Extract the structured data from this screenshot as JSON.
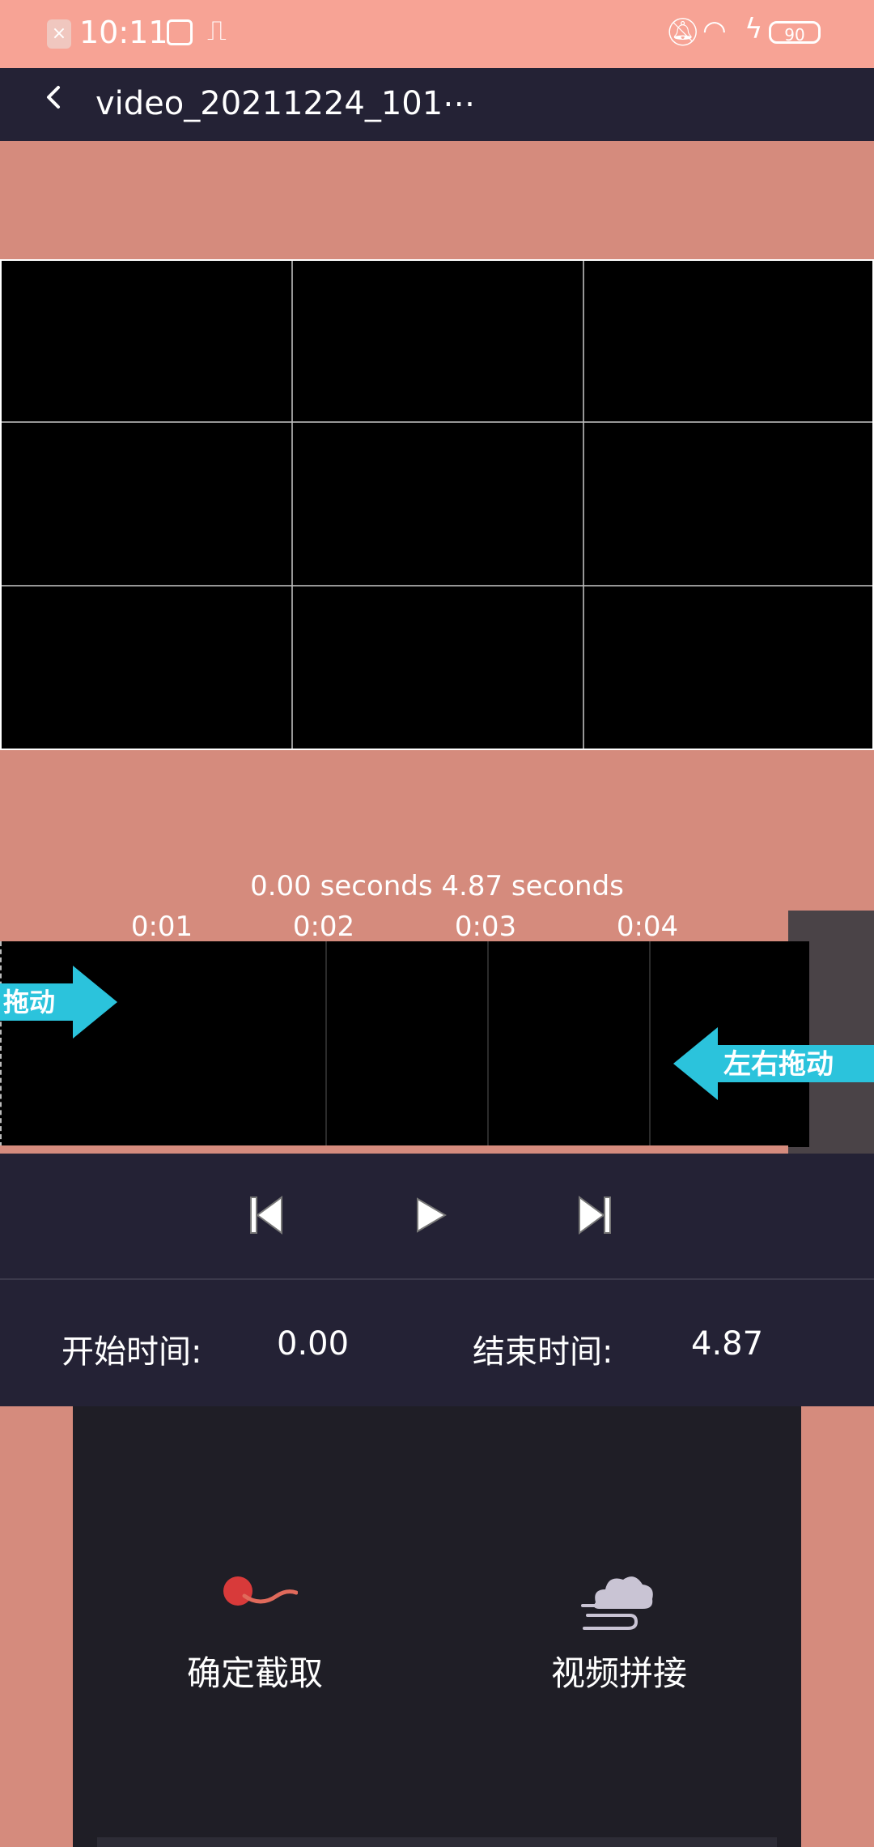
{
  "status_bar": {
    "time": "10:11",
    "battery": "90"
  },
  "header": {
    "title": "video_20211224_101⋯"
  },
  "timeline": {
    "range_label": "0.00 seconds 4.87 seconds",
    "ticks": [
      "0:01",
      "0:02",
      "0:03",
      "0:04"
    ],
    "drag_left_text": "拖动",
    "drag_right_text": "左右拖动"
  },
  "times": {
    "start_label": "开始时间:",
    "start_value": "0.00",
    "end_label": "结束时间:",
    "end_value": "4.87"
  },
  "actions": {
    "confirm_label": "确定截取",
    "concat_label": "视频拼接"
  },
  "colors": {
    "background": "#d58b7d",
    "status_bar": "#f7a395",
    "header": "#242235",
    "accent_cyan": "#2bc3dc"
  }
}
